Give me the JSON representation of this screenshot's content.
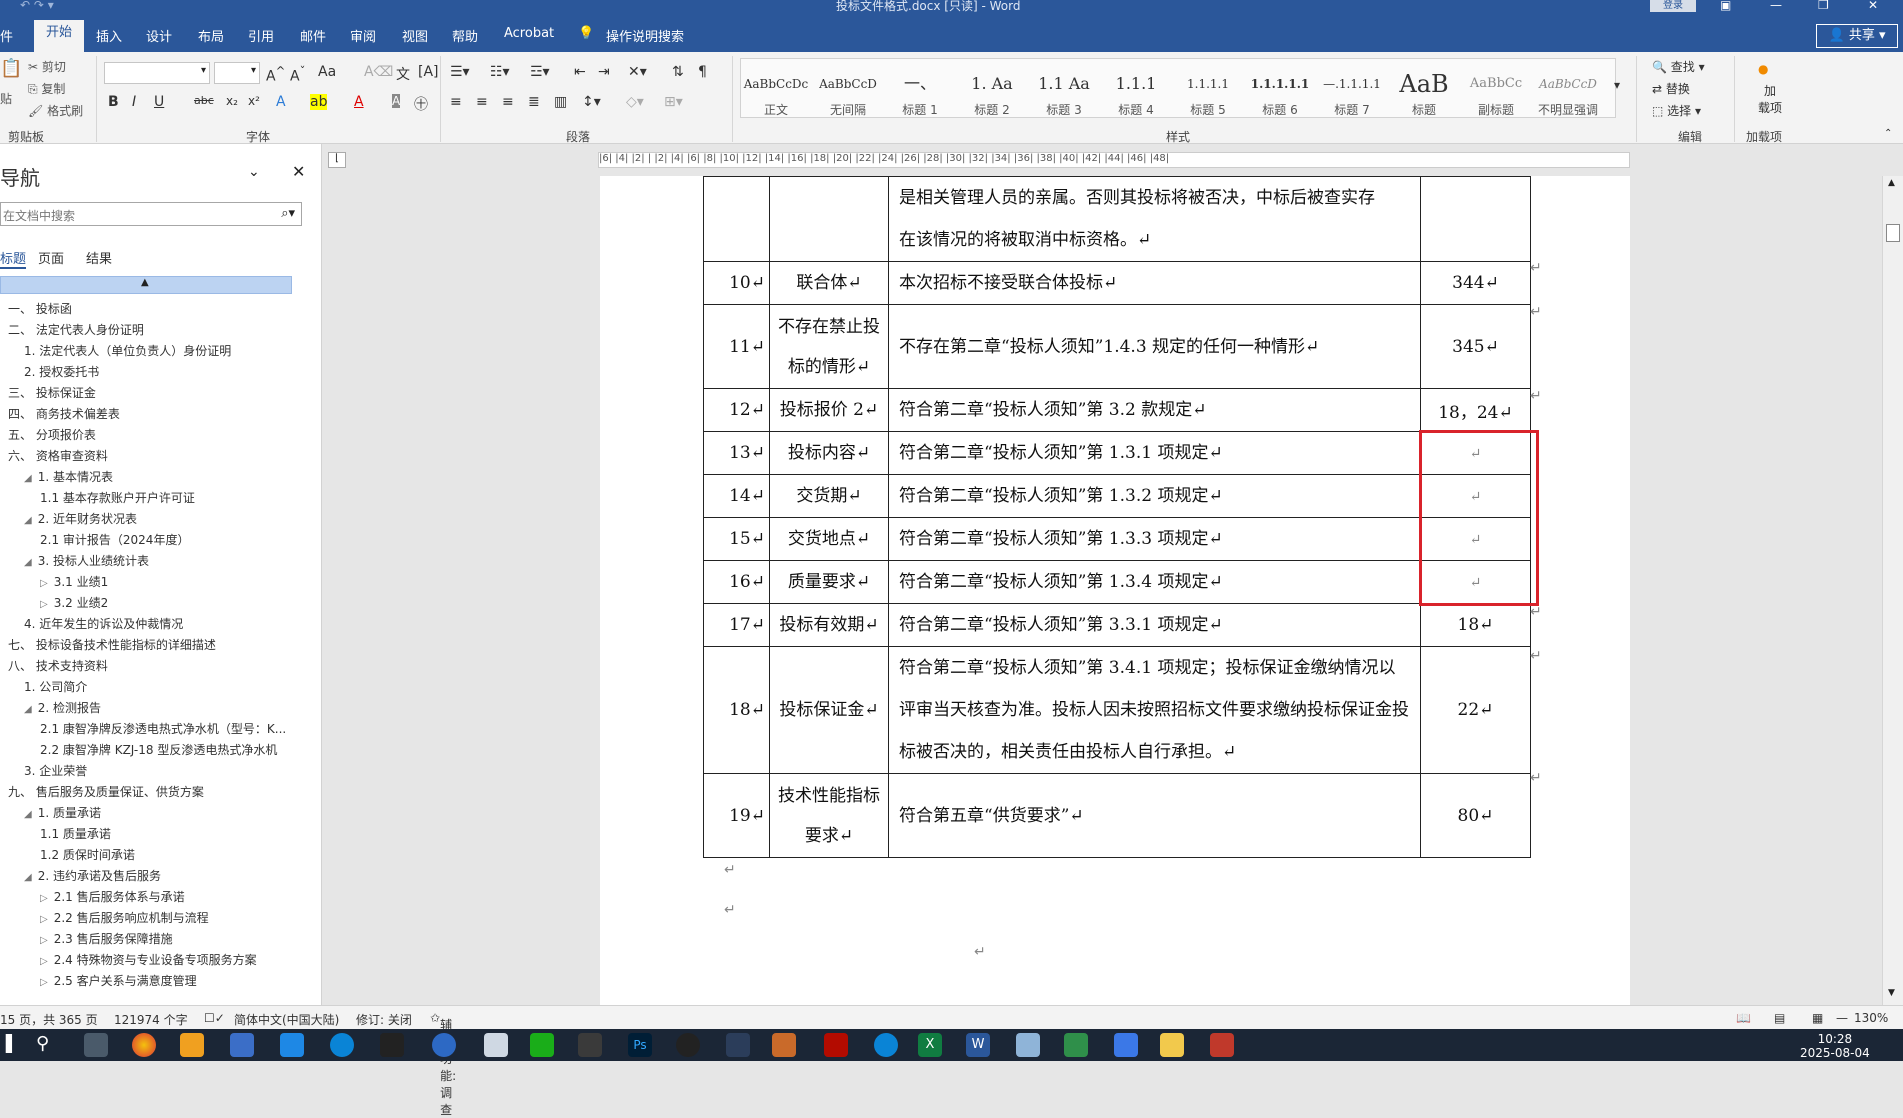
{
  "window": {
    "title": "投标文件格式.docx [只读] - Word",
    "login": "登录",
    "share": "共享"
  },
  "tabs": [
    "件",
    "开始",
    "插入",
    "设计",
    "布局",
    "引用",
    "邮件",
    "审阅",
    "视图",
    "帮助",
    "Acrobat",
    "操作说明搜索"
  ],
  "active_tab": "开始",
  "ribbon": {
    "clipboard": {
      "paste": "贴",
      "cut": "剪切",
      "copy": "复制",
      "format_painter": "格式刷",
      "label": "剪贴板"
    },
    "font": {
      "label": "字体",
      "font_name": "",
      "font_size": "",
      "aa": "Aa"
    },
    "paragraph": {
      "label": "段落"
    },
    "styles": {
      "label": "样式",
      "items": [
        {
          "preview": "AaBbCcDc",
          "name": "正文"
        },
        {
          "preview": "AaBbCcD",
          "name": "无间隔"
        },
        {
          "preview": "一、",
          "name": "标题 1"
        },
        {
          "preview": "1. Aa",
          "name": "标题 2"
        },
        {
          "preview": "1.1 Aa",
          "name": "标题 3"
        },
        {
          "preview": "1.1.1",
          "name": "标题 4"
        },
        {
          "preview": "1.1.1.1",
          "name": "标题 5"
        },
        {
          "preview": "1.1.1.1.1",
          "name": "标题 6"
        },
        {
          "preview": "—.1.1.1.1",
          "name": "标题 7"
        },
        {
          "preview": "AaB",
          "name": "标题"
        },
        {
          "preview": "AaBbCc",
          "name": "副标题"
        },
        {
          "preview": "AaBbCcD",
          "name": "不明显强调"
        }
      ]
    },
    "editing": {
      "label": "编辑",
      "find": "查找",
      "replace": "替换",
      "select": "选择"
    },
    "addins": {
      "label": "加载项",
      "load": "加\n载项"
    }
  },
  "nav": {
    "title": "导航",
    "search_placeholder": "在文档中搜索",
    "tabs": [
      "标题",
      "页面",
      "结果"
    ],
    "items": [
      {
        "text": "一、 投标函",
        "level": 0,
        "tri": ""
      },
      {
        "text": "二、 法定代表人身份证明",
        "level": 0,
        "tri": ""
      },
      {
        "text": "1. 法定代表人（单位负责人）身份证明",
        "level": 1,
        "tri": ""
      },
      {
        "text": "2. 授权委托书",
        "level": 1,
        "tri": ""
      },
      {
        "text": "三、 投标保证金",
        "level": 0,
        "tri": ""
      },
      {
        "text": "四、 商务技术偏差表",
        "level": 0,
        "tri": ""
      },
      {
        "text": "五、 分项报价表",
        "level": 0,
        "tri": ""
      },
      {
        "text": "六、 资格审查资料",
        "level": 0,
        "tri": ""
      },
      {
        "text": "1. 基本情况表",
        "level": 1,
        "tri": "◢"
      },
      {
        "text": "1.1 基本存款账户开户许可证",
        "level": 2,
        "tri": ""
      },
      {
        "text": "2. 近年财务状况表",
        "level": 1,
        "tri": "◢"
      },
      {
        "text": "2.1 审计报告（2024年度）",
        "level": 2,
        "tri": ""
      },
      {
        "text": "3. 投标人业绩统计表",
        "level": 1,
        "tri": "◢"
      },
      {
        "text": "3.1 业绩1",
        "level": 2,
        "tri": "▷"
      },
      {
        "text": "3.2 业绩2",
        "level": 2,
        "tri": "▷"
      },
      {
        "text": "4. 近年发生的诉讼及仲裁情况",
        "level": 1,
        "tri": ""
      },
      {
        "text": "七、 投标设备技术性能指标的详细描述",
        "level": 0,
        "tri": ""
      },
      {
        "text": "八、 技术支持资料",
        "level": 0,
        "tri": ""
      },
      {
        "text": "1. 公司简介",
        "level": 1,
        "tri": ""
      },
      {
        "text": "2. 检测报告",
        "level": 1,
        "tri": "◢"
      },
      {
        "text": "2.1 康智净牌反渗透电热式净水机（型号：K...",
        "level": 2,
        "tri": ""
      },
      {
        "text": "2.2 康智净牌 KZJ-18 型反渗透电热式净水机",
        "level": 2,
        "tri": ""
      },
      {
        "text": "3. 企业荣誉",
        "level": 1,
        "tri": ""
      },
      {
        "text": "九、 售后服务及质量保证、供货方案",
        "level": 0,
        "tri": ""
      },
      {
        "text": "1. 质量承诺",
        "level": 1,
        "tri": "◢"
      },
      {
        "text": "1.1 质量承诺",
        "level": 2,
        "tri": ""
      },
      {
        "text": "1.2 质保时间承诺",
        "level": 2,
        "tri": ""
      },
      {
        "text": "2. 违约承诺及售后服务",
        "level": 1,
        "tri": "◢"
      },
      {
        "text": "2.1 售后服务体系与承诺",
        "level": 2,
        "tri": "▷"
      },
      {
        "text": "2.2 售后服务响应机制与流程",
        "level": 2,
        "tri": "▷"
      },
      {
        "text": "2.3 售后服务保障措施",
        "level": 2,
        "tri": "▷"
      },
      {
        "text": "2.4 特殊物资与专业设备专项服务方案",
        "level": 2,
        "tri": "▷"
      },
      {
        "text": "2.5 客户关系与满意度管理",
        "level": 2,
        "tri": "▷"
      }
    ]
  },
  "table": {
    "top_row_text": [
      "是相关管理人员的亲属。否则其投标将被否决，中标后被查实存",
      "在该情况的将被取消中标资格。↵"
    ],
    "rows": [
      {
        "no": "10↵",
        "item": "联合体↵",
        "std": "本次招标不接受联合体投标↵",
        "page": "344↵"
      },
      {
        "no": "11↵",
        "item": "不存在禁止投标的情形↵",
        "std": "不存在第二章“投标人须知”1.4.3 规定的任何一种情形↵",
        "page": "345↵"
      },
      {
        "no": "12↵",
        "item": "投标报价 2↵",
        "std": "符合第二章“投标人须知”第 3.2 款规定↵",
        "page": "18，24↵"
      },
      {
        "no": "13↵",
        "item": "投标内容↵",
        "std": "符合第二章“投标人须知”第 1.3.1 项规定↵",
        "page": "↵"
      },
      {
        "no": "14↵",
        "item": "交货期↵",
        "std": "符合第二章“投标人须知”第 1.3.2 项规定↵",
        "page": "↵"
      },
      {
        "no": "15↵",
        "item": "交货地点↵",
        "std": "符合第二章“投标人须知”第 1.3.3 项规定↵",
        "page": "↵"
      },
      {
        "no": "16↵",
        "item": "质量要求↵",
        "std": "符合第二章“投标人须知”第 1.3.4 项规定↵",
        "page": "↵"
      },
      {
        "no": "17↵",
        "item": "投标有效期↵",
        "std": "符合第二章“投标人须知”第 3.3.1 项规定↵",
        "page": "18↵"
      },
      {
        "no": "18↵",
        "item": "投标保证金↵",
        "std": "符合第二章“投标人须知”第 3.4.1 项规定；投标保证金缴纳情况以评审当天核查为准。投标人因未按照招标文件要求缴纳投标保证金投标被否决的，相关责任由投标人自行承担。↵",
        "page": "22↵"
      },
      {
        "no": "19↵",
        "item": "技术性能指标要求↵",
        "std": "符合第五章“供货要求”↵",
        "page": "80↵"
      }
    ]
  },
  "status": {
    "page": "15 页，共 365 页",
    "words": "121974 个字",
    "lang": "简体中文(中国大陆)",
    "track": "修订: 关闭",
    "access": "辅助功能: 调查",
    "zoom": "130%"
  },
  "clock": {
    "time": "10:28",
    "date": "2025-08-04"
  },
  "colors": {
    "accent": "#2b579a",
    "highlight_box": "#d9232b"
  }
}
